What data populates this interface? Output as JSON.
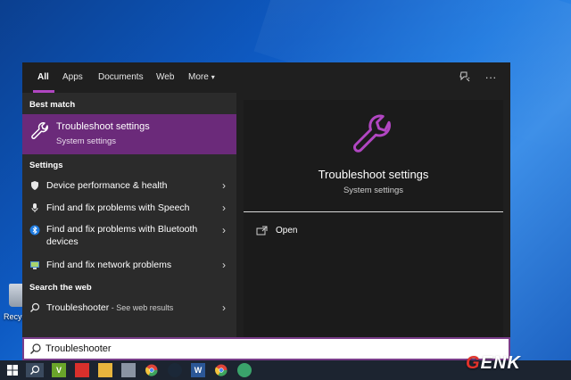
{
  "desktop": {
    "recycle_bin_label": "Recyc"
  },
  "tabs": [
    {
      "label": "All",
      "active": true
    },
    {
      "label": "Apps"
    },
    {
      "label": "Documents"
    },
    {
      "label": "Web"
    },
    {
      "label": "More"
    }
  ],
  "tab_more_caret": "▾",
  "header_icons": [
    "feedback-icon",
    "more-options-icon"
  ],
  "more_options_glyph": "···",
  "best_match": {
    "heading": "Best match",
    "title": "Troubleshoot settings",
    "subtitle": "System settings",
    "icon": "wrench-icon"
  },
  "settings": {
    "heading": "Settings",
    "items": [
      {
        "label": "Device performance & health",
        "icon": "shield-icon"
      },
      {
        "label": "Find and fix problems with Speech",
        "icon": "microphone-icon"
      },
      {
        "label": "Find and fix problems with Bluetooth devices",
        "icon": "bluetooth-icon"
      },
      {
        "label": "Find and fix network problems",
        "icon": "network-icon"
      }
    ]
  },
  "web": {
    "heading": "Search the web",
    "query": "Troubleshooter",
    "suffix": " - See web results",
    "icon": "search-icon"
  },
  "chevron": "›",
  "preview": {
    "title": "Troubleshoot settings",
    "subtitle": "System settings",
    "open_label": "Open",
    "icon": "wrench-icon"
  },
  "search": {
    "value": "Troubleshooter"
  },
  "taskbar": {
    "items": [
      "windows-start-icon",
      "search-icon",
      "v-app-icon",
      "red-app-icon",
      "file-explorer-icon",
      "pc-app-icon",
      "chrome-icon",
      "steam-icon",
      "word-icon",
      "chrome-alt-icon",
      "green-app-icon"
    ],
    "word_letter": "W",
    "v_letter": "V"
  },
  "watermark": {
    "g_letter": "G",
    "rest": "ENK"
  },
  "colors": {
    "accent": "#b146c2",
    "best_match_bg": "#6b2a7a",
    "panel_bg": "#2b2b2b",
    "preview_bg": "#1b1b1b"
  }
}
